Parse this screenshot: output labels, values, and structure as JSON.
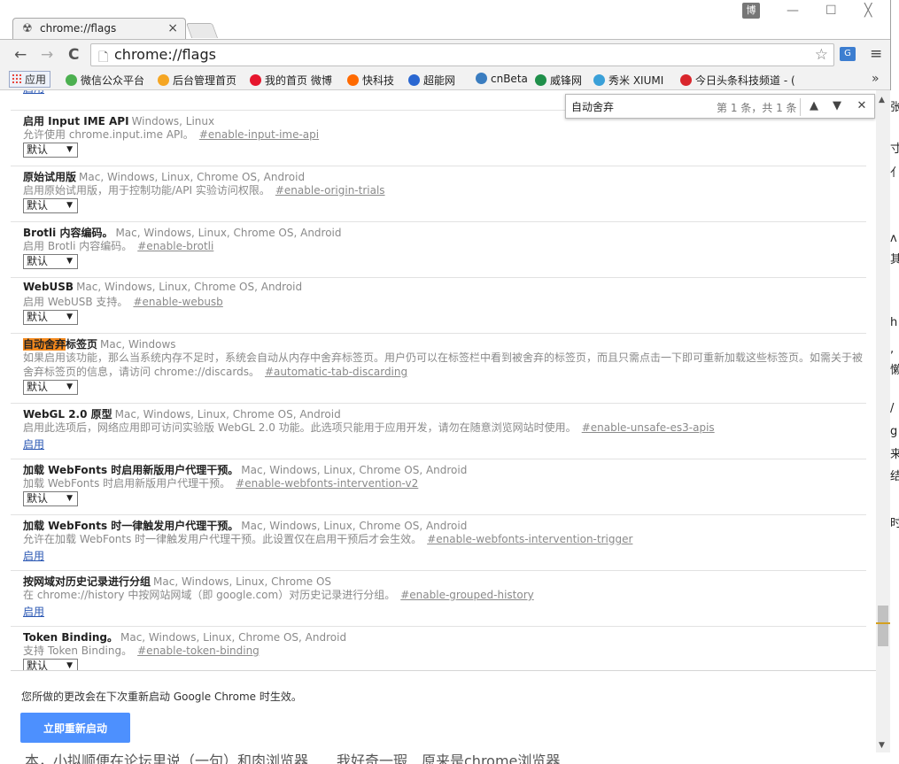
{
  "tab": {
    "title": "chrome://flags",
    "close": "×"
  },
  "window": {
    "profile": "博",
    "minimize": "—",
    "maximize": "☐",
    "close": "╳"
  },
  "toolbar": {
    "back": "←",
    "forward": "→",
    "reload": "C",
    "url": "chrome://flags",
    "menu": "≡"
  },
  "bookmarks": {
    "apps": "应用",
    "items": [
      {
        "label": "微信公众平台",
        "color": "#4cb050"
      },
      {
        "label": "后台管理首页",
        "color": "#f5a623"
      },
      {
        "label": "我的首页 微博",
        "color": "#e6162d"
      },
      {
        "label": "快科技",
        "color": "#ff6a00"
      },
      {
        "label": "超能网",
        "color": "#2a67d1"
      },
      {
        "label": "cnBeta",
        "color": "#3a7dc0"
      },
      {
        "label": "威锋网",
        "color": "#1f8f4a"
      },
      {
        "label": "秀米 XIUMI",
        "color": "#3aa0d8"
      },
      {
        "label": "今日头条科技频道 - (",
        "color": "#d9262c"
      }
    ],
    "more": "»"
  },
  "find": {
    "query": "自动舍弃",
    "count": "第 1 条，共 1 条",
    "prev": "▲",
    "next": "▼",
    "close": "✕"
  },
  "flags": [
    {
      "name": "",
      "platforms": "",
      "desc": "",
      "link": "",
      "control": "link",
      "value": "启用"
    },
    {
      "name": "启用 Input IME API",
      "platforms": "Windows, Linux",
      "desc": "允许使用 chrome.input.ime API。",
      "link": "#enable-input-ime-api",
      "control": "select",
      "value": "默认"
    },
    {
      "name": "原始试用版",
      "platforms": "Mac, Windows, Linux, Chrome OS, Android",
      "desc": "启用原始试用版，用于控制功能/API 实验访问权限。",
      "link": "#enable-origin-trials",
      "control": "select",
      "value": "默认"
    },
    {
      "name": "Brotli 内容编码。",
      "platforms": "Mac, Windows, Linux, Chrome OS, Android",
      "desc": "启用 Brotli 内容编码。",
      "link": "#enable-brotli",
      "control": "select",
      "value": "默认"
    },
    {
      "name": "WebUSB",
      "platforms": "Mac, Windows, Linux, Chrome OS, Android",
      "desc": "启用 WebUSB 支持。",
      "link": "#enable-webusb",
      "control": "select",
      "value": "默认"
    },
    {
      "name_hl": "自动舍弃",
      "name_rest": "标签页",
      "platforms": "Mac, Windows",
      "desc": "如果启用该功能，那么当系统内存不足时，系统会自动从内存中舍弃标签页。用户仍可以在标签栏中看到被舍弃的标签页，而且只需点击一下即可重新加载这些标签页。如需关于被舍弃标签页的信息，请访问 chrome://discards。",
      "link": "#automatic-tab-discarding",
      "control": "select",
      "value": "默认"
    },
    {
      "name": "WebGL 2.0 原型",
      "platforms": "Mac, Windows, Linux, Chrome OS, Android",
      "desc": "启用此选项后，网络应用即可访问实验版 WebGL 2.0 功能。此选项只能用于应用开发，请勿在随意浏览网站时使用。",
      "link": "#enable-unsafe-es3-apis",
      "control": "link",
      "value": "启用"
    },
    {
      "name": "加载 WebFonts 时启用新版用户代理干预。",
      "platforms": "Mac, Windows, Linux, Chrome OS, Android",
      "desc": "加载 WebFonts 时启用新版用户代理干预。",
      "link": "#enable-webfonts-intervention-v2",
      "control": "select",
      "value": "默认"
    },
    {
      "name": "加载 WebFonts 时一律触发用户代理干预。",
      "platforms": "Mac, Windows, Linux, Chrome OS, Android",
      "desc": "允许在加载 WebFonts 时一律触发用户代理干预。此设置仅在启用干预后才会生效。",
      "link": "#enable-webfonts-intervention-trigger",
      "control": "link",
      "value": "启用"
    },
    {
      "name": "按网域对历史记录进行分组",
      "platforms": "Mac, Windows, Linux, Chrome OS",
      "desc": "在 chrome://history 中按网站网域（即 google.com）对历史记录进行分组。",
      "link": "#enable-grouped-history",
      "control": "link",
      "value": "启用"
    },
    {
      "name": "Token Binding。",
      "platforms": "Mac, Windows, Linux, Chrome OS, Android",
      "desc": "支持 Token Binding。",
      "link": "#enable-token-binding",
      "control": "select",
      "value": "默认"
    }
  ],
  "restart": {
    "message": "您所做的更改会在下次重新启动 Google Chrome 时生效。",
    "button": "立即重新启动"
  },
  "background": {
    "right_chars": [
      "张",
      "寸",
      "亻",
      "ʌ",
      "其",
      "h",
      ",",
      "懒",
      "/",
      "g",
      "来",
      "结",
      "时"
    ],
    "bottom_text": "本，小拟顺便在论坛里说（一句）和肉浏览器　　我好奇一瑕　原来是chrome浏览器"
  }
}
